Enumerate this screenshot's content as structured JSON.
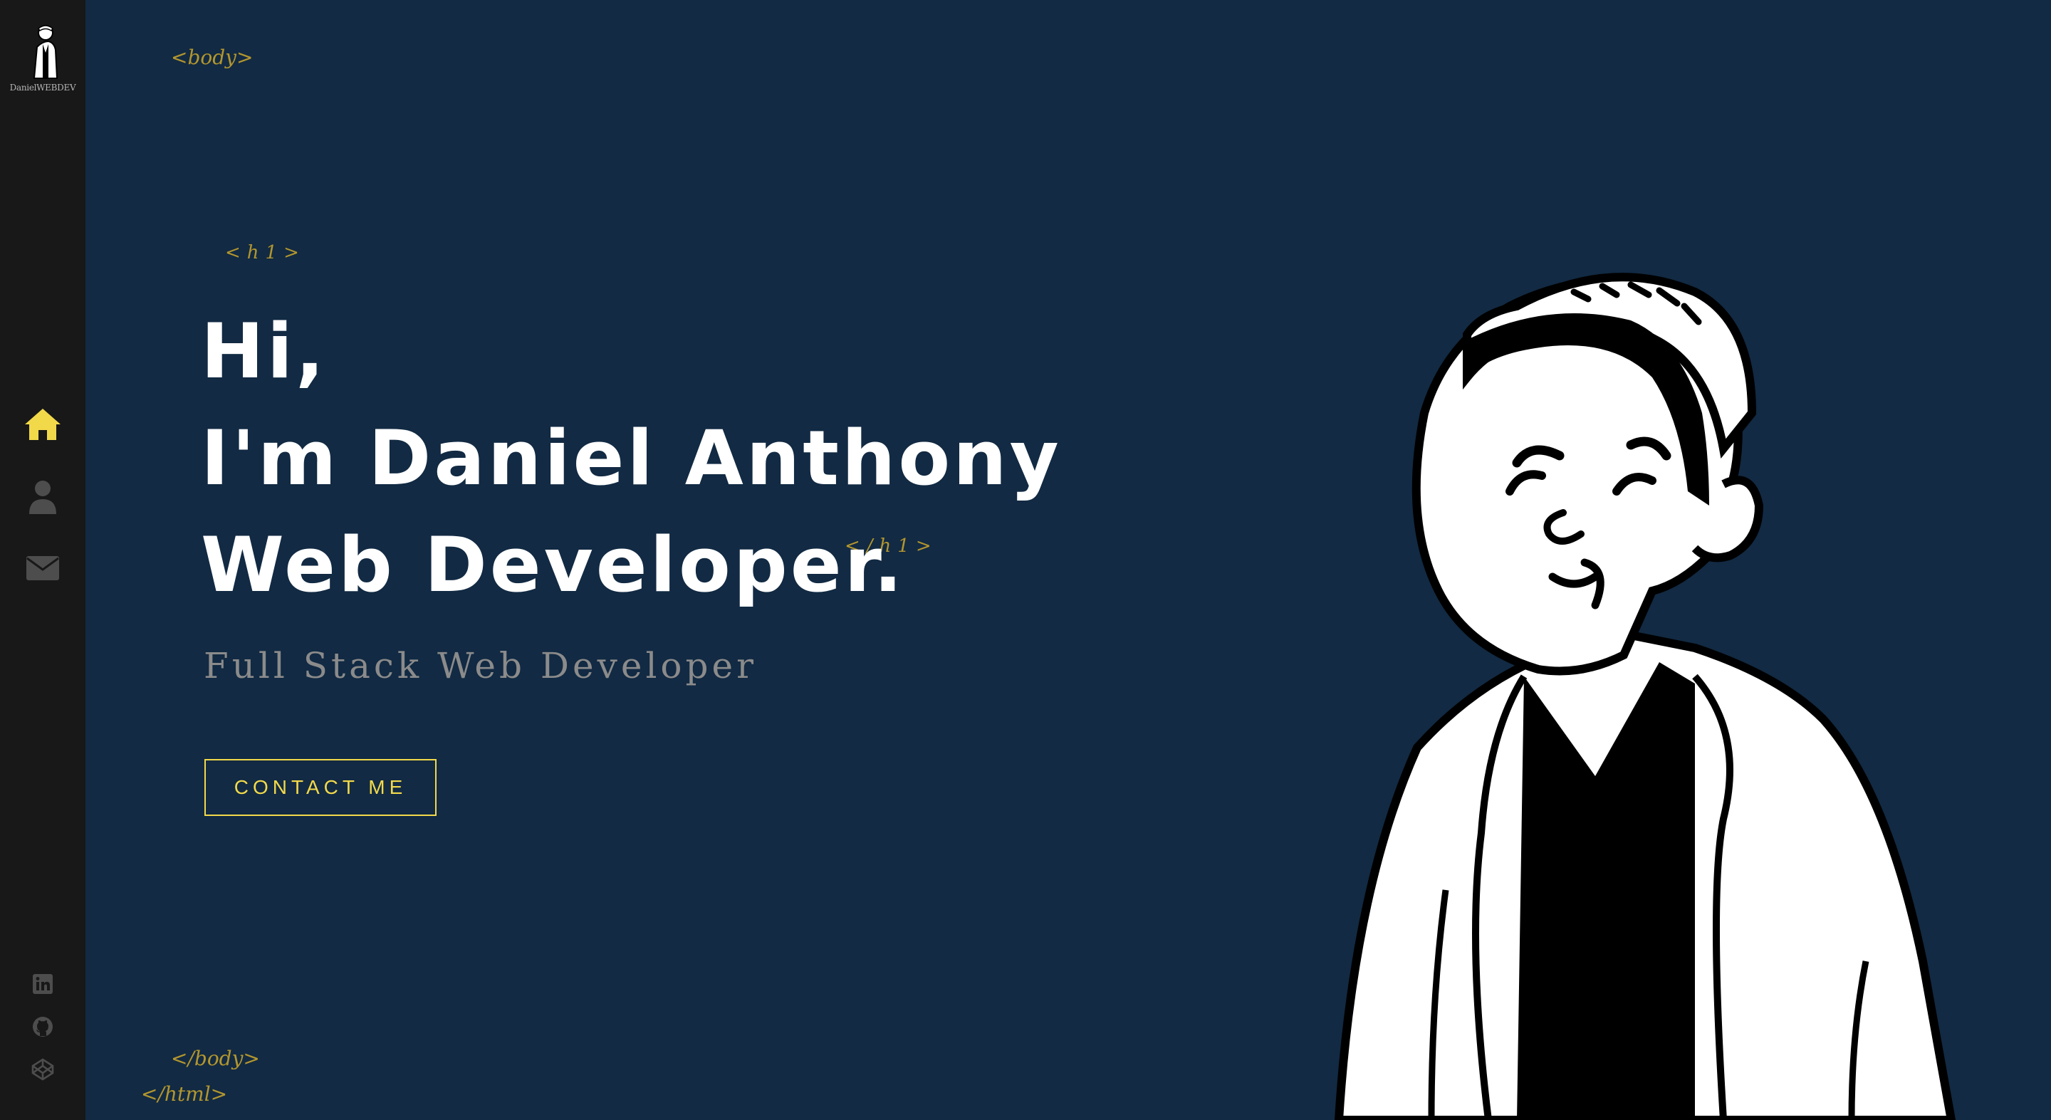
{
  "sidebar": {
    "logo_text": "DanielWEBDEV",
    "nav": [
      {
        "icon": "home-icon",
        "active": true
      },
      {
        "icon": "user-icon",
        "active": false
      },
      {
        "icon": "envelope-icon",
        "active": false
      }
    ],
    "social": [
      {
        "icon": "linkedin-icon"
      },
      {
        "icon": "github-icon"
      },
      {
        "icon": "codepen-icon"
      }
    ]
  },
  "tags": {
    "body_open": "<body>",
    "h1_open": "<h1>",
    "h1_close": "</h1>",
    "body_close": "</body>",
    "html_close": "</html>"
  },
  "hero": {
    "line1": "Hi,",
    "line2": "I'm Daniel Anthony",
    "line3": "Web Developer.",
    "subtitle": "Full Stack Web Developer",
    "cta_label": "CONTACT ME"
  },
  "colors": {
    "background": "#122a43",
    "sidebar": "#181818",
    "accent": "#f2d94a",
    "tag": "#b3962e",
    "icon_inactive": "#4d4d4d"
  }
}
